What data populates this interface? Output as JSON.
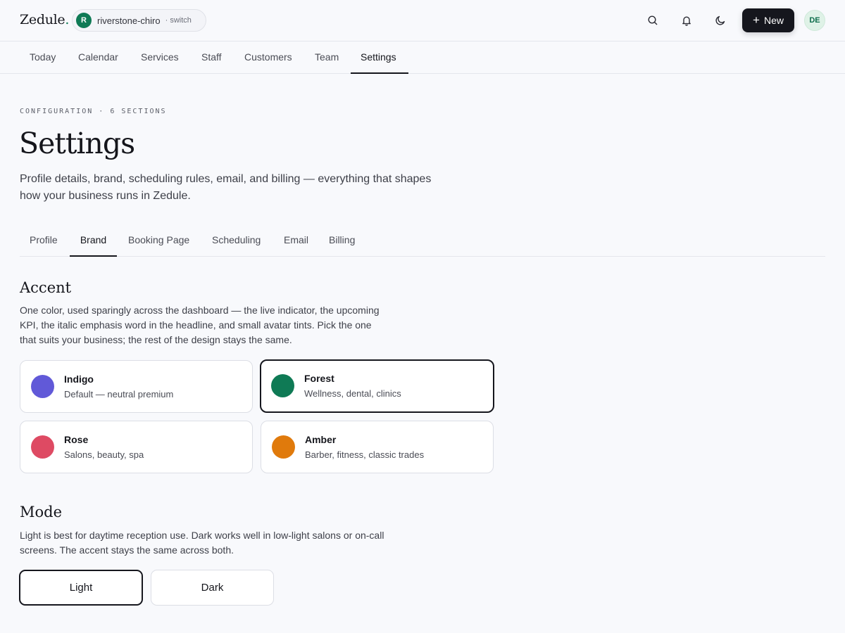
{
  "app": {
    "logo": "Zedule",
    "logo_dot": ".",
    "workspace_initial": "R",
    "workspace_name": "riverstone-chiro",
    "workspace_switch": "· switch",
    "new_button": "New",
    "user_initials": "DE",
    "accent_color": "#0f7a55"
  },
  "icons": {
    "search": "search-icon",
    "bell": "bell-icon",
    "moon": "moon-icon",
    "plus": "plus-icon"
  },
  "nav": {
    "items": [
      {
        "label": "Today"
      },
      {
        "label": "Calendar"
      },
      {
        "label": "Services"
      },
      {
        "label": "Staff"
      },
      {
        "label": "Customers"
      },
      {
        "label": "Team"
      },
      {
        "label": "Settings",
        "active": true
      }
    ]
  },
  "header": {
    "eyebrow": "CONFIGURATION · 6 SECTIONS",
    "title": "Settings",
    "description": "Profile details, brand, scheduling rules, email, and billing — everything that shapes how your business runs in Zedule."
  },
  "tabs": {
    "items": [
      {
        "label": "Profile"
      },
      {
        "label": "Brand",
        "active": true
      },
      {
        "label": "Booking Page"
      },
      {
        "label": "Scheduling"
      },
      {
        "label": "Email"
      },
      {
        "label": "Billing"
      }
    ]
  },
  "accent": {
    "title": "Accent",
    "description": "One color, used sparingly across the dashboard — the live indicator, the upcoming KPI, the italic emphasis word in the headline, and small avatar tints. Pick the one that suits your business; the rest of the design stays the same.",
    "options": [
      {
        "name": "Indigo",
        "sub": "Default — neutral premium",
        "color": "#6159d8",
        "selected": false
      },
      {
        "name": "Forest",
        "sub": "Wellness, dental, clinics",
        "color": "#0f7a55",
        "selected": true
      },
      {
        "name": "Rose",
        "sub": "Salons, beauty, spa",
        "color": "#de4a63",
        "selected": false
      },
      {
        "name": "Amber",
        "sub": "Barber, fitness, classic trades",
        "color": "#e07a0c",
        "selected": false
      }
    ]
  },
  "mode": {
    "title": "Mode",
    "description": "Light is best for daytime reception use. Dark works well in low-light salons or on-call screens. The accent stays the same across both.",
    "options": [
      {
        "label": "Light",
        "selected": true
      },
      {
        "label": "Dark",
        "selected": false
      }
    ]
  }
}
